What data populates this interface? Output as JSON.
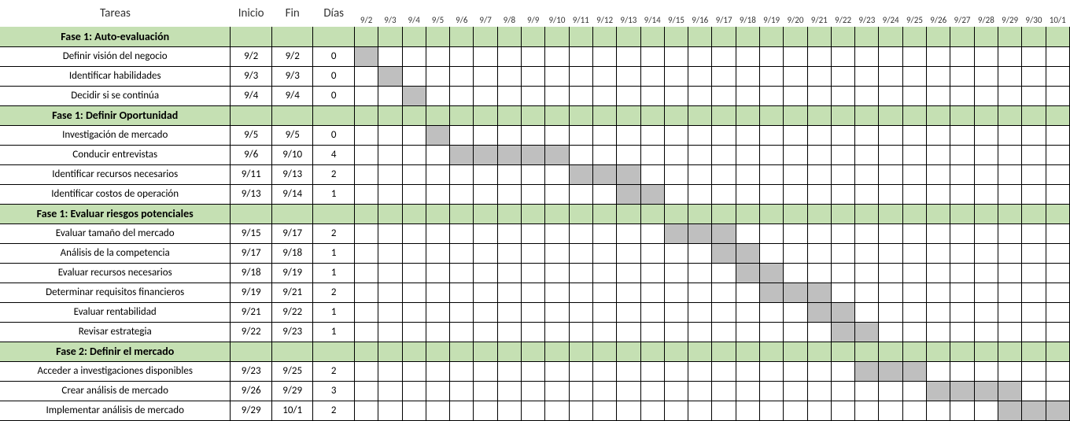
{
  "headers": {
    "task": "Tareas",
    "start": "Inicio",
    "end": "Fin",
    "days": "Días"
  },
  "dates": [
    "9/2",
    "9/3",
    "9/4",
    "9/5",
    "9/6",
    "9/7",
    "9/8",
    "9/9",
    "9/10",
    "9/11",
    "9/12",
    "9/13",
    "9/14",
    "9/15",
    "9/16",
    "9/17",
    "9/18",
    "9/19",
    "9/20",
    "9/21",
    "9/22",
    "9/23",
    "9/24",
    "9/25",
    "9/26",
    "9/27",
    "9/28",
    "9/29",
    "9/30",
    "10/1"
  ],
  "rows": [
    {
      "type": "phase",
      "label": "Fase 1: Auto-evaluación"
    },
    {
      "type": "task",
      "label": "Definir visión del negocio",
      "start": "9/2",
      "end": "9/2",
      "days": "0",
      "bar_from": "9/2",
      "bar_to": "9/2"
    },
    {
      "type": "task",
      "label": "Identificar habilidades",
      "start": "9/3",
      "end": "9/3",
      "days": "0",
      "bar_from": "9/3",
      "bar_to": "9/3"
    },
    {
      "type": "task",
      "label": "Decidir si se continúa",
      "start": "9/4",
      "end": "9/4",
      "days": "0",
      "bar_from": "9/4",
      "bar_to": "9/4"
    },
    {
      "type": "phase",
      "label": "Fase 1: Definir Oportunidad"
    },
    {
      "type": "task",
      "label": "Investigación de mercado",
      "start": "9/5",
      "end": "9/5",
      "days": "0",
      "bar_from": "9/5",
      "bar_to": "9/5"
    },
    {
      "type": "task",
      "label": "Conducir entrevistas",
      "start": "9/6",
      "end": "9/10",
      "days": "4",
      "bar_from": "9/6",
      "bar_to": "9/10"
    },
    {
      "type": "task",
      "label": "Identificar recursos necesarios",
      "start": "9/11",
      "end": "9/13",
      "days": "2",
      "bar_from": "9/11",
      "bar_to": "9/13"
    },
    {
      "type": "task",
      "label": "Identificar costos de operación",
      "start": "9/13",
      "end": "9/14",
      "days": "1",
      "bar_from": "9/13",
      "bar_to": "9/14"
    },
    {
      "type": "phase",
      "label": "Fase 1: Evaluar riesgos potenciales"
    },
    {
      "type": "task",
      "label": "Evaluar tamaño del mercado",
      "start": "9/15",
      "end": "9/17",
      "days": "2",
      "bar_from": "9/15",
      "bar_to": "9/17"
    },
    {
      "type": "task",
      "label": "Análisis de la competencia",
      "start": "9/17",
      "end": "9/18",
      "days": "1",
      "bar_from": "9/17",
      "bar_to": "9/18"
    },
    {
      "type": "task",
      "label": "Evaluar recursos necesarios",
      "start": "9/18",
      "end": "9/19",
      "days": "1",
      "bar_from": "9/18",
      "bar_to": "9/19"
    },
    {
      "type": "task",
      "label": "Determinar requisitos financieros",
      "start": "9/19",
      "end": "9/21",
      "days": "2",
      "bar_from": "9/19",
      "bar_to": "9/21"
    },
    {
      "type": "task",
      "label": "Evaluar rentabilidad",
      "start": "9/21",
      "end": "9/22",
      "days": "1",
      "bar_from": "9/21",
      "bar_to": "9/22"
    },
    {
      "type": "task",
      "label": "Revisar estrategia",
      "start": "9/22",
      "end": "9/23",
      "days": "1",
      "bar_from": "9/22",
      "bar_to": "9/23"
    },
    {
      "type": "phase",
      "label": "Fase 2: Definir el mercado"
    },
    {
      "type": "task",
      "label": "Acceder a investigaciones disponibles",
      "start": "9/23",
      "end": "9/25",
      "days": "2",
      "bar_from": "9/23",
      "bar_to": "9/25"
    },
    {
      "type": "task",
      "label": "Crear análisis de mercado",
      "start": "9/26",
      "end": "9/29",
      "days": "3",
      "bar_from": "9/26",
      "bar_to": "9/29"
    },
    {
      "type": "task",
      "label": "Implementar análisis de mercado",
      "start": "9/29",
      "end": "10/1",
      "days": "2",
      "bar_from": "9/29",
      "bar_to": "10/1"
    }
  ],
  "chart_data": {
    "type": "gantt",
    "title": "",
    "x_axis_dates": [
      "9/2",
      "9/3",
      "9/4",
      "9/5",
      "9/6",
      "9/7",
      "9/8",
      "9/9",
      "9/10",
      "9/11",
      "9/12",
      "9/13",
      "9/14",
      "9/15",
      "9/16",
      "9/17",
      "9/18",
      "9/19",
      "9/20",
      "9/21",
      "9/22",
      "9/23",
      "9/24",
      "9/25",
      "9/26",
      "9/27",
      "9/28",
      "9/29",
      "9/30",
      "10/1"
    ],
    "phases": [
      {
        "name": "Fase 1: Auto-evaluación",
        "tasks": [
          {
            "name": "Definir visión del negocio",
            "start": "9/2",
            "end": "9/2",
            "duration_days": 0
          },
          {
            "name": "Identificar habilidades",
            "start": "9/3",
            "end": "9/3",
            "duration_days": 0
          },
          {
            "name": "Decidir si se continúa",
            "start": "9/4",
            "end": "9/4",
            "duration_days": 0
          }
        ]
      },
      {
        "name": "Fase 1: Definir Oportunidad",
        "tasks": [
          {
            "name": "Investigación de mercado",
            "start": "9/5",
            "end": "9/5",
            "duration_days": 0
          },
          {
            "name": "Conducir entrevistas",
            "start": "9/6",
            "end": "9/10",
            "duration_days": 4
          },
          {
            "name": "Identificar recursos necesarios",
            "start": "9/11",
            "end": "9/13",
            "duration_days": 2
          },
          {
            "name": "Identificar costos de operación",
            "start": "9/13",
            "end": "9/14",
            "duration_days": 1
          }
        ]
      },
      {
        "name": "Fase 1: Evaluar riesgos potenciales",
        "tasks": [
          {
            "name": "Evaluar tamaño del mercado",
            "start": "9/15",
            "end": "9/17",
            "duration_days": 2
          },
          {
            "name": "Análisis de la competencia",
            "start": "9/17",
            "end": "9/18",
            "duration_days": 1
          },
          {
            "name": "Evaluar recursos necesarios",
            "start": "9/18",
            "end": "9/19",
            "duration_days": 1
          },
          {
            "name": "Determinar requisitos financieros",
            "start": "9/19",
            "end": "9/21",
            "duration_days": 2
          },
          {
            "name": "Evaluar rentabilidad",
            "start": "9/21",
            "end": "9/22",
            "duration_days": 1
          },
          {
            "name": "Revisar estrategia",
            "start": "9/22",
            "end": "9/23",
            "duration_days": 1
          }
        ]
      },
      {
        "name": "Fase 2: Definir el mercado",
        "tasks": [
          {
            "name": "Acceder a investigaciones disponibles",
            "start": "9/23",
            "end": "9/25",
            "duration_days": 2
          },
          {
            "name": "Crear análisis de mercado",
            "start": "9/26",
            "end": "9/29",
            "duration_days": 3
          },
          {
            "name": "Implementar análisis de mercado",
            "start": "9/29",
            "end": "10/1",
            "duration_days": 2
          }
        ]
      }
    ],
    "colors": {
      "phase_fill": "#c5e0b3",
      "bar_fill": "#bfbfbf",
      "grid": "#000000"
    }
  }
}
